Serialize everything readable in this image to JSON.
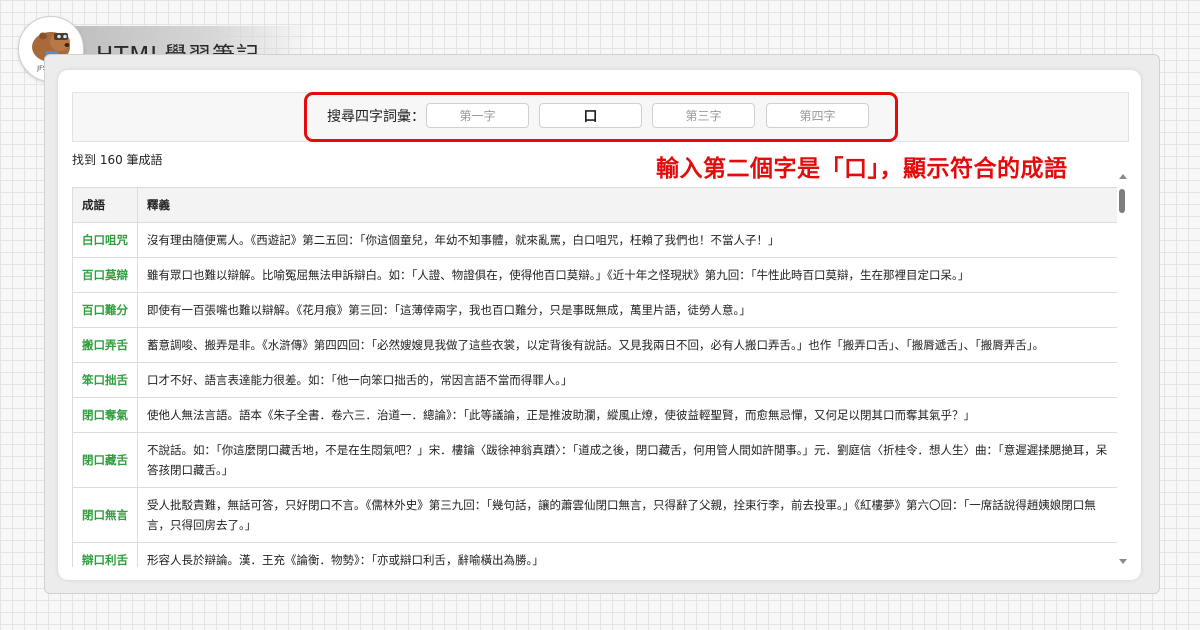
{
  "brand": {
    "title": "HTML學習筆記",
    "logo_text": "JFSBLOG",
    "logo_icon": "capybara-mascot-icon"
  },
  "search": {
    "label": "搜尋四字詞彙：",
    "inputs": [
      {
        "value": "",
        "placeholder": "第一字"
      },
      {
        "value": "口",
        "placeholder": "第二字"
      },
      {
        "value": "",
        "placeholder": "第三字"
      },
      {
        "value": "",
        "placeholder": "第四字"
      }
    ]
  },
  "annotation": "輸入第二個字是「口」，顯示符合的成語",
  "result_count": "找到 160 筆成語",
  "table": {
    "headers": [
      "成語",
      "釋義"
    ],
    "rows": [
      {
        "idiom": "白口咀咒",
        "meaning": "沒有理由隨便罵人。《西遊記》第二五回：「你這個童兒，年幼不知事體，就來亂罵，白口咀咒，枉賴了我們也！不當人子！」"
      },
      {
        "idiom": "百口莫辯",
        "meaning": "雖有眾口也難以辯解。比喻冤屈無法申訴辯白。如：「人證、物證俱在，使得他百口莫辯。」《近十年之怪現狀》第九回：「牛性此時百口莫辯，生在那裡目定口呆。」"
      },
      {
        "idiom": "百口難分",
        "meaning": "即使有一百張嘴也難以辯解。《花月痕》第三回：「這薄倖兩字，我也百口難分，只是事既無成，萬里片語，徒勞人意。」"
      },
      {
        "idiom": "搬口弄舌",
        "meaning": "蓄意調唆、搬弄是非。《水滸傳》第四四回：「必然嫂嫂見我做了這些衣裳，以定背後有說話。又見我兩日不回，必有人搬口弄舌。」也作「搬弄口舌」、「搬脣遞舌」、「搬脣弄舌」。"
      },
      {
        "idiom": "笨口拙舌",
        "meaning": "口才不好、語言表達能力很差。如：「他一向笨口拙舌的，常因言語不當而得罪人。」"
      },
      {
        "idiom": "閉口奪氣",
        "meaning": "使他人無法言語。語本《朱子全書．卷六三．治道一．總論》：「此等議論，正是推波助瀾，縱風止燎，使彼益輕聖賢，而愈無忌憚，又何足以閉其口而奪其氣乎？」"
      },
      {
        "idiom": "閉口藏舌",
        "meaning": "不說話。如：「你這麼閉口藏舌地，不是在生悶氣吧？」宋．樓鑰〈跋徐神翁真蹟〉：「道成之後，閉口藏舌，何用管人間如許閒事。」元．劉庭信〈折桂令．想人生〉曲：「意遲遲揉腮撧耳，呆答孩閉口藏舌。」"
      },
      {
        "idiom": "閉口無言",
        "meaning": "受人批駁責難，無話可答，只好閉口不言。《儒林外史》第三九回：「幾句話，讓的蕭雲仙閉口無言，只得辭了父親，拴束行李，前去投軍。」《紅樓夢》第六〇回：「一席話說得趙姨娘閉口無言，只得回房去了。」"
      },
      {
        "idiom": "辯口利舌",
        "meaning": "形容人長於辯論。漢．王充《論衡．物勢》：「亦或辯口利舌，辭喻橫出為勝。」"
      }
    ]
  },
  "colors": {
    "accent_red": "#e30b0b",
    "idiom_green": "#2f9f3d"
  }
}
